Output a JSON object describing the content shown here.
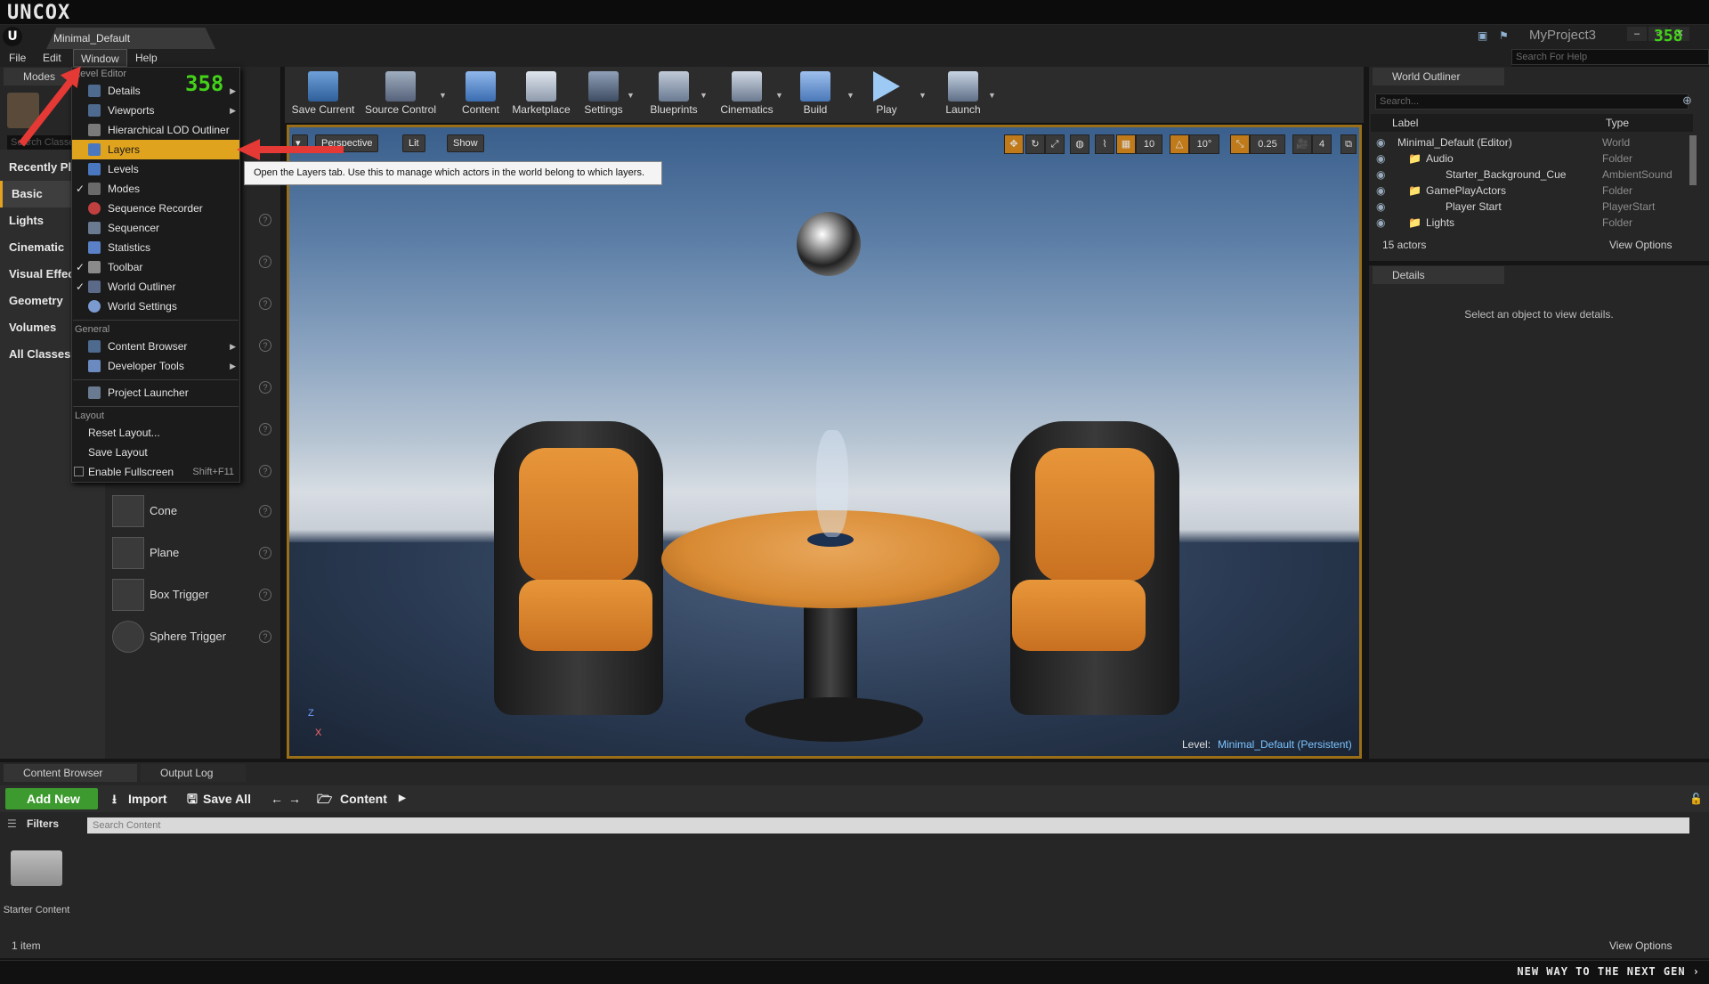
{
  "brand": {
    "logo_text": "UNCOX",
    "tagline": "NEW WAY TO THE NEXT GEN ›"
  },
  "titlebar": {
    "tab": "Minimal_Default",
    "project": "MyProject3",
    "fps": "358"
  },
  "help_search": {
    "placeholder": "Search For Help"
  },
  "menubar": {
    "items": [
      "File",
      "Edit",
      "Window",
      "Help"
    ]
  },
  "modes": {
    "tab": "Modes",
    "search_placeholder": "Search Classes",
    "categories": [
      "Recently Placed",
      "Basic",
      "Lights",
      "Cinematic",
      "Visual Effects",
      "Geometry",
      "Volumes",
      "All Classes"
    ],
    "primitives": [
      "Cone",
      "Plane",
      "Box Trigger",
      "Sphere Trigger"
    ]
  },
  "window_menu": {
    "section_level_editor": "Level Editor",
    "fps": "358",
    "items": [
      {
        "label": "Details",
        "checked": false,
        "submenu": true
      },
      {
        "label": "Viewports",
        "checked": false,
        "submenu": true
      },
      {
        "label": "Hierarchical LOD Outliner",
        "checked": false,
        "submenu": false
      },
      {
        "label": "Layers",
        "checked": false,
        "submenu": false,
        "highlighted": true
      },
      {
        "label": "Levels",
        "checked": false,
        "submenu": false
      },
      {
        "label": "Modes",
        "checked": true,
        "submenu": false
      },
      {
        "label": "Sequence Recorder",
        "checked": false,
        "submenu": false
      },
      {
        "label": "Sequencer",
        "checked": false,
        "submenu": false
      },
      {
        "label": "Statistics",
        "checked": false,
        "submenu": false
      },
      {
        "label": "Toolbar",
        "checked": true,
        "submenu": false
      },
      {
        "label": "World Outliner",
        "checked": true,
        "submenu": false
      },
      {
        "label": "World Settings",
        "checked": false,
        "submenu": false
      }
    ],
    "section_general": "General",
    "general_items": [
      {
        "label": "Content Browser",
        "submenu": true
      },
      {
        "label": "Developer Tools",
        "submenu": true
      },
      {
        "label": "Project Launcher",
        "submenu": false
      }
    ],
    "section_layout": "Layout",
    "layout_items": [
      {
        "label": "Reset Layout..."
      },
      {
        "label": "Save Layout"
      },
      {
        "label": "Enable Fullscreen",
        "shortcut": "Shift+F11"
      }
    ],
    "tooltip": "Open the Layers tab. Use this to manage which actors in the world belong to which layers."
  },
  "toolbar": {
    "buttons": [
      "Save Current",
      "Source Control",
      "Content",
      "Marketplace",
      "Settings",
      "Blueprints",
      "Cinematics",
      "Build",
      "Play",
      "Launch"
    ]
  },
  "viewport": {
    "perspective": "Perspective",
    "lit": "Lit",
    "show": "Show",
    "grid_snap": "10",
    "rotation_snap": "10°",
    "scale_snap": "0.25",
    "camera_speed": "4",
    "level_label": "Level:",
    "level_name": "Minimal_Default (Persistent)",
    "axis_labels": [
      "Z",
      "X"
    ]
  },
  "outliner": {
    "tab": "World Outliner",
    "search_placeholder": "Search...",
    "col_label": "Label",
    "col_type": "Type",
    "rows": [
      {
        "label": "Minimal_Default (Editor)",
        "type": "World",
        "indent": 0
      },
      {
        "label": "Audio",
        "type": "Folder",
        "indent": 1
      },
      {
        "label": "Starter_Background_Cue",
        "type": "AmbientSound",
        "indent": 2
      },
      {
        "label": "GamePlayActors",
        "type": "Folder",
        "indent": 1
      },
      {
        "label": "Player Start",
        "type": "PlayerStart",
        "indent": 2
      },
      {
        "label": "Lights",
        "type": "Folder",
        "indent": 1
      }
    ],
    "footer_count": "15 actors",
    "view_options": "View Options"
  },
  "details": {
    "tab": "Details",
    "message": "Select an object to view details."
  },
  "content_browser": {
    "tabs": [
      "Content Browser",
      "Output Log"
    ],
    "add_new": "Add New",
    "import": "Import",
    "save_all": "Save All",
    "path": "Content",
    "filters": "Filters",
    "search_placeholder": "Search Content",
    "folder_name": "Starter Content",
    "items_count": "1 item",
    "view_options": "View Options"
  },
  "colors": {
    "accent": "#e0a31e",
    "fps": "#43d11a",
    "add_new": "#3c9a2e",
    "arrow": "#e53935",
    "level_link": "#7cc4ff"
  }
}
